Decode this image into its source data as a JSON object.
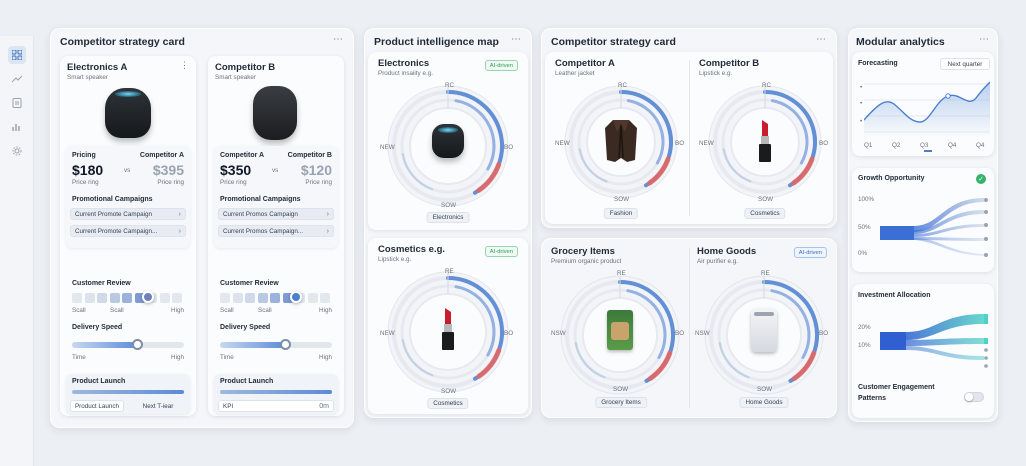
{
  "competitor_strategy_1": {
    "title": "Competitor strategy card",
    "card_a": {
      "name": "Electronics A",
      "sub": "Smart speaker",
      "price_label": "Pricing",
      "comp_label": "Competitor A",
      "price": "$180",
      "vs": "vs",
      "comp_price": "$395",
      "price_note": "Price ring",
      "comp_note": "Price ring",
      "promo_title": "Promotional Campaigns",
      "promos": [
        "Current Promote Campaign",
        "Current Promote Campaign..."
      ],
      "review_title": "Customer Review",
      "review_labels": [
        "Scall",
        "Scall",
        "High"
      ],
      "delivery_title": "Delivery Speed",
      "delivery_labels": [
        "Time",
        "High"
      ],
      "delivery_level": 0.6,
      "launch_title": "Product Launch",
      "launch_buttons": [
        "Product Launch",
        "Next T-iear"
      ]
    },
    "card_b": {
      "name": "Competitor B",
      "sub": "Smart speaker",
      "price_label": "Competitor A",
      "comp_label": "Competitor B",
      "price": "$350",
      "vs": "vs",
      "comp_price": "$120",
      "price_note": "Price ring",
      "comp_note": "Price ring",
      "promo_title": "Promotional Campaigns",
      "promos": [
        "Current Promos Campaign",
        "Current Promos Campaign..."
      ],
      "review_title": "Customer Review",
      "review_labels": [
        "Scall",
        "Scall",
        "High"
      ],
      "delivery_title": "Delivery Speed",
      "delivery_labels": [
        "Time",
        "High"
      ],
      "delivery_level": 0.6,
      "launch_title": "Product Launch",
      "launch_buttons": [
        "KPI",
        "0m"
      ]
    }
  },
  "product_map": {
    "title": "Product intelligence map",
    "card1": {
      "title": "Electronics",
      "sub": "Product insaiity e.g.",
      "tag": "AI-driven",
      "axes": [
        "RC",
        "NEW",
        "BO",
        "SOW"
      ],
      "label": "Electronics"
    },
    "card2": {
      "title": "Cosmetics e.g.",
      "sub": "Lipstick e.g.",
      "tag": "AI-driven",
      "axes": [
        "RE",
        "NEW",
        "BO",
        "SOW"
      ],
      "label": "Cosmetics"
    }
  },
  "competitor_strategy_2": {
    "title": "Competitor strategy card",
    "a": {
      "title": "Competitor A",
      "sub": "Leather jacket",
      "axes": [
        "RC",
        "NEW",
        "BO",
        "SOW"
      ],
      "label": "Fashion"
    },
    "b": {
      "title": "Competitor B",
      "sub": "Lipstick e.g.",
      "axes": [
        "RC",
        "NEW",
        "BO",
        "SOW"
      ],
      "label": "Cosmetics"
    }
  },
  "grocery_panel": {
    "a": {
      "title": "Grocery Items",
      "sub": "Premium organic product",
      "axes": [
        "RE",
        "NSW",
        "BO",
        "SOW"
      ],
      "label": "Grocery Items"
    },
    "b": {
      "title": "Home Goods",
      "sub": "Air purifier e.g.",
      "tag": "AI-driven",
      "axes": [
        "RE",
        "NSW",
        "BO",
        "SOW"
      ],
      "label": "Home Goods"
    }
  },
  "modular": {
    "title": "Modular analytics",
    "forecast": {
      "title": "Forecasting",
      "button": "Next quarter",
      "x_labels": [
        "Q1",
        "Q2",
        "Q3",
        "Q4",
        "Q4"
      ]
    },
    "growth": {
      "title": "Growth Opportunity",
      "y_labels": [
        "100%",
        "50%",
        "0%"
      ]
    },
    "investment": {
      "title": "Investment Allocation",
      "y_labels": [
        "20%",
        "10%"
      ],
      "footer": "Customer Engagement Patterns"
    }
  },
  "colors": {
    "accent": "#3b6fb6",
    "ring_blue": "#4a7fd0",
    "ring_red": "#f0625a",
    "ai_green": "#2f9a5a"
  },
  "icons": [
    "grid-icon",
    "trend-icon",
    "document-icon",
    "bar-chart-icon",
    "settings-icon"
  ]
}
